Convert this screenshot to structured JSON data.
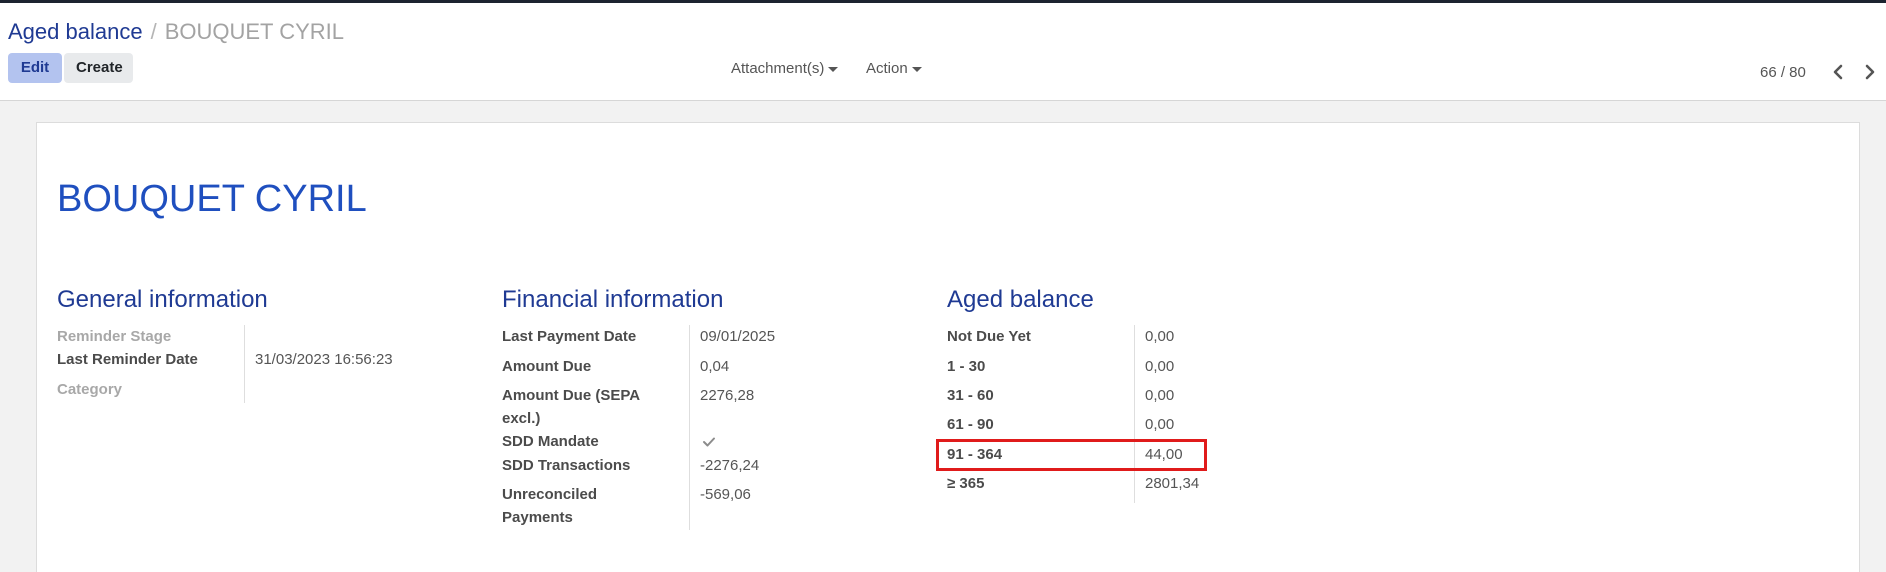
{
  "breadcrumb": {
    "parent": "Aged balance",
    "separator": "/",
    "current": "BOUQUET CYRIL"
  },
  "toolbar": {
    "edit_label": "Edit",
    "create_label": "Create",
    "attachments_label": "Attachment(s)",
    "action_label": "Action"
  },
  "pager": {
    "text": "66 / 80"
  },
  "record": {
    "title": "BOUQUET CYRIL"
  },
  "general": {
    "title": "General information",
    "reminder_stage_label": "Reminder Stage",
    "reminder_stage_value": "",
    "last_reminder_date_label": "Last Reminder Date",
    "last_reminder_date_value": "31/03/2023 16:56:23",
    "category_label": "Category",
    "category_value": ""
  },
  "financial": {
    "title": "Financial information",
    "last_payment_date_label": "Last Payment Date",
    "last_payment_date_value": "09/01/2025",
    "amount_due_label": "Amount Due",
    "amount_due_value": "0,04",
    "amount_due_sepa_label_1": "Amount Due (SEPA",
    "amount_due_sepa_label_2": "excl.)",
    "amount_due_sepa_value": "2276,28",
    "sdd_mandate_label": "SDD Mandate",
    "sdd_mandate_checked": true,
    "sdd_transactions_label": "SDD Transactions",
    "sdd_transactions_value": "-2276,24",
    "unreconciled_label_1": "Unreconciled",
    "unreconciled_label_2": "Payments",
    "unreconciled_value": "-569,06"
  },
  "aged": {
    "title": "Aged balance",
    "rows": [
      {
        "label": "Not Due Yet",
        "value": "0,00"
      },
      {
        "label": "1 - 30",
        "value": "0,00"
      },
      {
        "label": "31 - 60",
        "value": "0,00"
      },
      {
        "label": "61 - 90",
        "value": "0,00"
      },
      {
        "label": "91 - 364",
        "value": "44,00"
      },
      {
        "label": "≥ 365",
        "value": "2801,34"
      }
    ]
  },
  "colors": {
    "accent": "#1f3a93",
    "title": "#1f4fbf",
    "highlight_border": "#e01b1b"
  },
  "icons": {
    "prev": "chevron-left-icon",
    "next": "chevron-right-icon",
    "caret": "caret-down-icon",
    "check": "checkmark-icon"
  }
}
